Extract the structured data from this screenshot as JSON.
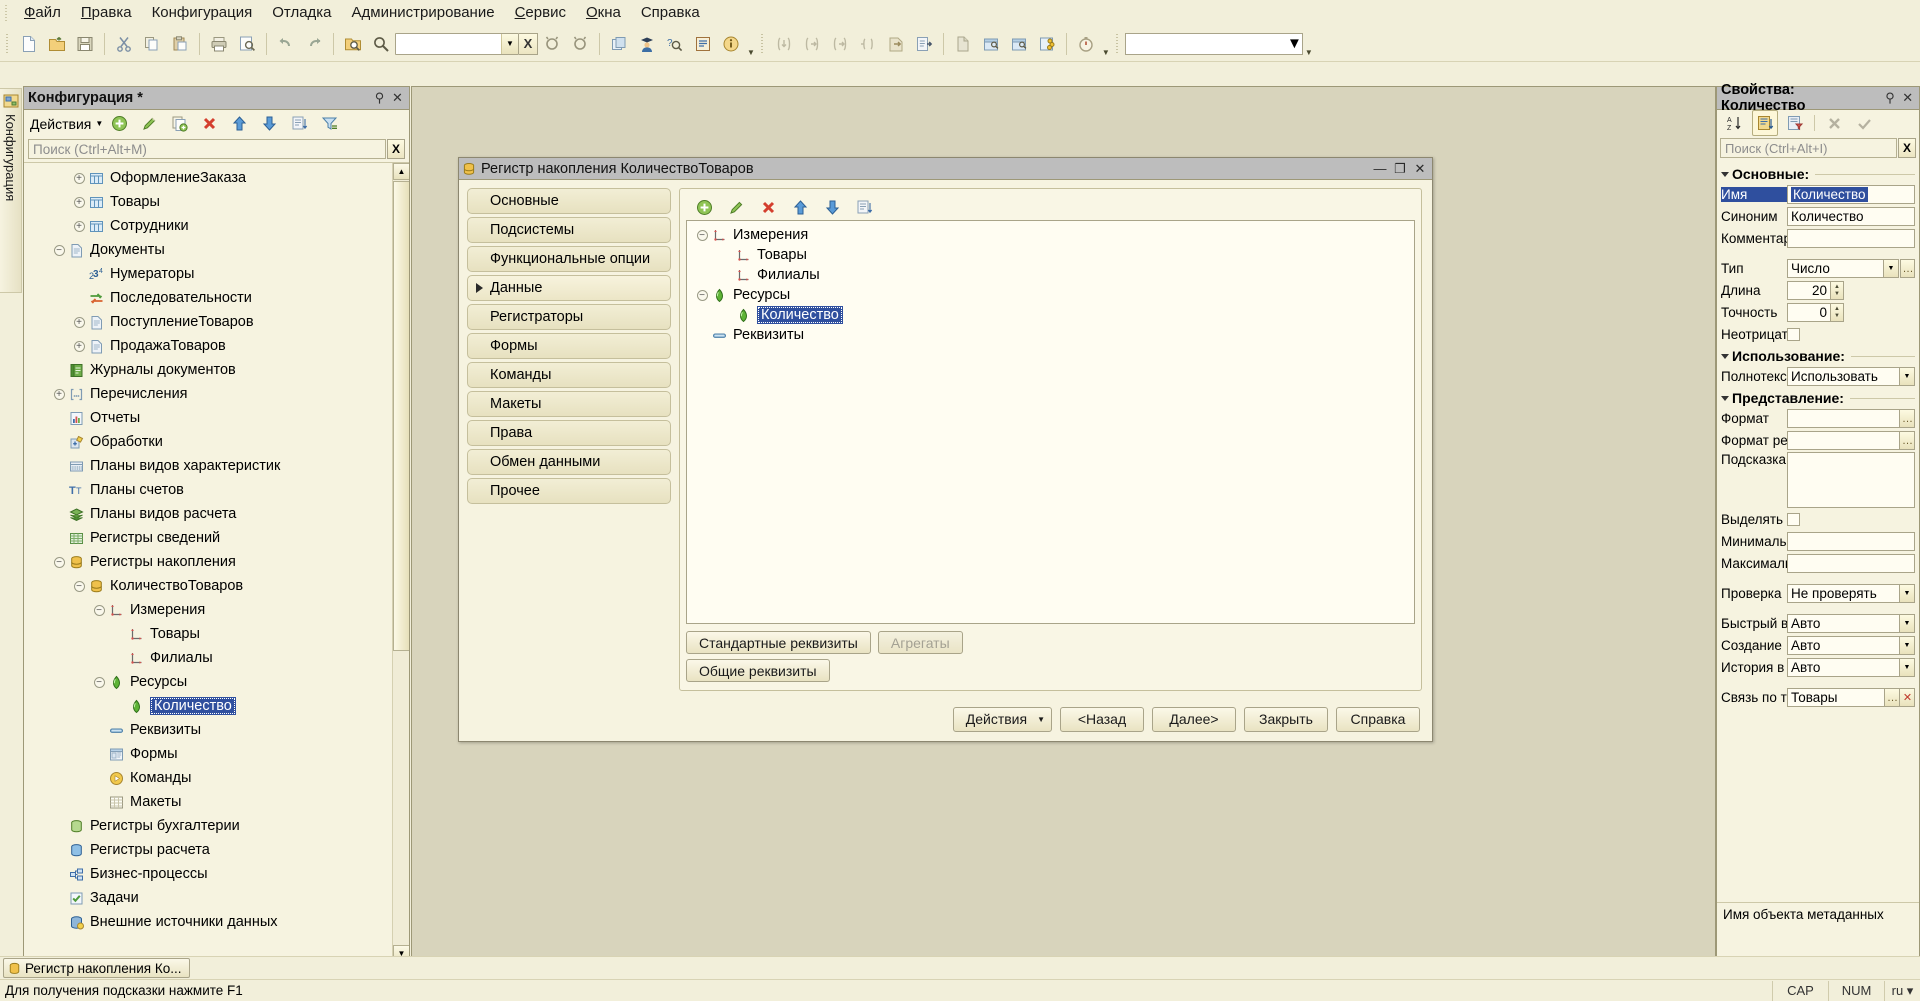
{
  "menu": {
    "items": [
      {
        "label": "Файл",
        "accel": "Ф"
      },
      {
        "label": "Правка",
        "accel": "П"
      },
      {
        "label": "Конфигурация",
        "accel": ""
      },
      {
        "label": "Отладка",
        "accel": ""
      },
      {
        "label": "Администрирование",
        "accel": ""
      },
      {
        "label": "Сервис",
        "accel": "С"
      },
      {
        "label": "Окна",
        "accel": "О"
      },
      {
        "label": "Справка",
        "accel": ""
      }
    ]
  },
  "toolbar": {
    "icons": [
      "new-file-icon",
      "open-folder-icon",
      "save-icon",
      "cut-icon",
      "copy-icon",
      "paste-icon",
      "print-icon",
      "print-preview-icon",
      "undo-icon",
      "redo-icon",
      "find-in-folder-icon",
      "search-icon"
    ],
    "search_value": "",
    "clear_label": "X",
    "icons2": [
      "user-icon",
      "find-user-icon",
      "syntax-helper-icon",
      "info-icon"
    ],
    "icons3": [
      "step-into-icon",
      "step-over-icon",
      "step-out-icon",
      "goto-line-icon",
      "run-to-cursor-icon",
      "next-statement-icon"
    ],
    "icons4": [
      "document-icon",
      "window-new-icon",
      "window-new2-icon",
      "config-compare-icon",
      "performance-icon"
    ],
    "combo2_value": ""
  },
  "vertical_tab": {
    "label": "Конфигурация"
  },
  "config_panel": {
    "title": "Конфигурация *",
    "actions_label": "Действия",
    "action_icons": [
      "add-icon",
      "edit-icon",
      "copy-add-icon",
      "delete-icon",
      "move-up-icon",
      "move-down-icon",
      "sort-icon",
      "filter-icon"
    ],
    "search_placeholder": "Поиск (Ctrl+Alt+M)",
    "search_clear": "X",
    "pin_icon": "pin-icon",
    "close_icon": "close-icon",
    "tree": [
      {
        "label": "ОформлениеЗаказа",
        "indent": 2,
        "expander": "+",
        "icon": "catalog-icon"
      },
      {
        "label": "Товары",
        "indent": 2,
        "expander": "+",
        "icon": "catalog-icon"
      },
      {
        "label": "Сотрудники",
        "indent": 2,
        "expander": "+",
        "icon": "catalog-icon"
      },
      {
        "label": "Документы",
        "indent": 1,
        "expander": "-",
        "icon": "document-icon"
      },
      {
        "label": "Нумераторы",
        "indent": 2,
        "expander": "",
        "icon": "numerator-icon"
      },
      {
        "label": "Последовательности",
        "indent": 2,
        "expander": "",
        "icon": "sequence-icon"
      },
      {
        "label": "ПоступлениеТоваров",
        "indent": 2,
        "expander": "+",
        "icon": "document-icon"
      },
      {
        "label": "ПродажаТоваров",
        "indent": 2,
        "expander": "+",
        "icon": "document-icon"
      },
      {
        "label": "Журналы документов",
        "indent": 1,
        "expander": "",
        "icon": "journal-icon"
      },
      {
        "label": "Перечисления",
        "indent": 1,
        "expander": "+",
        "icon": "enum-icon"
      },
      {
        "label": "Отчеты",
        "indent": 1,
        "expander": "",
        "icon": "report-icon"
      },
      {
        "label": "Обработки",
        "indent": 1,
        "expander": "",
        "icon": "dataproc-icon"
      },
      {
        "label": "Планы видов характеристик",
        "indent": 1,
        "expander": "",
        "icon": "chartofcharacteristic-icon"
      },
      {
        "label": "Планы счетов",
        "indent": 1,
        "expander": "",
        "icon": "chartofaccounts-icon"
      },
      {
        "label": "Планы видов расчета",
        "indent": 1,
        "expander": "",
        "icon": "chartofcalc-icon"
      },
      {
        "label": "Регистры сведений",
        "indent": 1,
        "expander": "",
        "icon": "inforegister-icon"
      },
      {
        "label": "Регистры накопления",
        "indent": 1,
        "expander": "-",
        "icon": "accumregister-icon"
      },
      {
        "label": "КоличествоТоваров",
        "indent": 2,
        "expander": "-",
        "icon": "accumregister-icon"
      },
      {
        "label": "Измерения",
        "indent": 3,
        "expander": "-",
        "icon": "dimension-icon"
      },
      {
        "label": "Товары",
        "indent": 4,
        "expander": "",
        "icon": "dimension-icon"
      },
      {
        "label": "Филиалы",
        "indent": 4,
        "expander": "",
        "icon": "dimension-icon"
      },
      {
        "label": "Ресурсы",
        "indent": 3,
        "expander": "-",
        "icon": "resource-icon"
      },
      {
        "label": "Количество",
        "indent": 4,
        "expander": "",
        "icon": "resource-icon",
        "selected": true
      },
      {
        "label": "Реквизиты",
        "indent": 3,
        "expander": "",
        "icon": "attribute-icon"
      },
      {
        "label": "Формы",
        "indent": 3,
        "expander": "",
        "icon": "form-icon"
      },
      {
        "label": "Команды",
        "indent": 3,
        "expander": "",
        "icon": "command-icon"
      },
      {
        "label": "Макеты",
        "indent": 3,
        "expander": "",
        "icon": "template-icon"
      },
      {
        "label": "Регистры бухгалтерии",
        "indent": 1,
        "expander": "",
        "icon": "accountregister-icon"
      },
      {
        "label": "Регистры расчета",
        "indent": 1,
        "expander": "",
        "icon": "calcregister-icon"
      },
      {
        "label": "Бизнес-процессы",
        "indent": 1,
        "expander": "",
        "icon": "businessprocess-icon"
      },
      {
        "label": "Задачи",
        "indent": 1,
        "expander": "",
        "icon": "task-icon"
      },
      {
        "label": "Внешние источники данных",
        "indent": 1,
        "expander": "",
        "icon": "externaldata-icon"
      }
    ]
  },
  "dialog": {
    "title": "Регистр накопления КоличествоТоваров",
    "icon": "accumregister-icon",
    "window_buttons": [
      "minimize",
      "maximize",
      "close"
    ],
    "nav_tabs": [
      {
        "label": "Основные",
        "active": false
      },
      {
        "label": "Подсистемы",
        "active": false
      },
      {
        "label": "Функциональные опции",
        "active": false
      },
      {
        "label": "Данные",
        "active": true
      },
      {
        "label": "Регистраторы",
        "active": false
      },
      {
        "label": "Формы",
        "active": false
      },
      {
        "label": "Команды",
        "active": false
      },
      {
        "label": "Макеты",
        "active": false
      },
      {
        "label": "Права",
        "active": false
      },
      {
        "label": "Обмен данными",
        "active": false
      },
      {
        "label": "Прочее",
        "active": false
      }
    ],
    "data_toolbar_icons": [
      "add-icon",
      "edit-icon",
      "delete-icon",
      "move-up-icon",
      "move-down-icon",
      "sort-icon"
    ],
    "data_tree": [
      {
        "label": "Измерения",
        "indent": 0,
        "expander": "-",
        "icon": "dimension-icon"
      },
      {
        "label": "Товары",
        "indent": 1,
        "expander": "",
        "icon": "dimension-icon"
      },
      {
        "label": "Филиалы",
        "indent": 1,
        "expander": "",
        "icon": "dimension-icon"
      },
      {
        "label": "Ресурсы",
        "indent": 0,
        "expander": "-",
        "icon": "resource-icon"
      },
      {
        "label": "Количество",
        "indent": 1,
        "expander": "",
        "icon": "resource-icon",
        "selected": true
      },
      {
        "label": "Реквизиты",
        "indent": 0,
        "expander": "",
        "icon": "attribute-icon"
      }
    ],
    "buttons": {
      "standard_attrs": "Стандартные реквизиты",
      "aggregates": "Агрегаты",
      "common_attrs": "Общие реквизиты",
      "actions": "Действия",
      "back": "<Назад",
      "next": "Далее>",
      "close": "Закрыть",
      "help": "Справка"
    }
  },
  "properties": {
    "title": "Свойства: Количество",
    "pin_icon": "pin-icon",
    "close_icon": "close-icon",
    "toolbar_icons": [
      "sort-az-icon",
      "group-by-category-icon",
      "filter-props-icon",
      "clear-icon",
      "apply-icon"
    ],
    "search_placeholder": "Поиск (Ctrl+Alt+I)",
    "search_clear": "X",
    "groups": [
      {
        "title": "Основные:",
        "rows": [
          {
            "label": "Имя",
            "value": "Количество",
            "type": "text",
            "label_selected": true,
            "value_selected": true
          },
          {
            "label": "Синоним",
            "value": "Количество",
            "type": "text"
          },
          {
            "label": "Комментар",
            "value": "",
            "type": "text"
          },
          {
            "label": "",
            "value": "",
            "type": "spacer"
          },
          {
            "label": "Тип",
            "value": "Число",
            "type": "combo-ellipsis"
          },
          {
            "label": "Длина",
            "value": "20",
            "type": "spinner"
          },
          {
            "label": "Точность",
            "value": "0",
            "type": "spinner"
          },
          {
            "label": "Неотрицат",
            "value": "",
            "type": "checkbox"
          }
        ]
      },
      {
        "title": "Использование:",
        "rows": [
          {
            "label": "Полнотекс",
            "value": "Использовать",
            "type": "combo"
          }
        ]
      },
      {
        "title": "Представление:",
        "rows": [
          {
            "label": "Формат",
            "value": "",
            "type": "ellipsis"
          },
          {
            "label": "Формат ре",
            "value": "",
            "type": "ellipsis"
          },
          {
            "label": "Подсказка",
            "value": "",
            "type": "multiline"
          },
          {
            "label": "Выделять ",
            "value": "",
            "type": "checkbox"
          },
          {
            "label": "Минималь",
            "value": "",
            "type": "text"
          },
          {
            "label": "Максималь",
            "value": "",
            "type": "text"
          },
          {
            "label": "",
            "value": "",
            "type": "spacer"
          },
          {
            "label": "Проверка ",
            "value": "Не проверять",
            "type": "combo"
          },
          {
            "label": "",
            "value": "",
            "type": "spacer"
          },
          {
            "label": "Быстрый в",
            "value": "Авто",
            "type": "combo"
          },
          {
            "label": "Создание ",
            "value": "Авто",
            "type": "combo"
          },
          {
            "label": "История в",
            "value": "Авто",
            "type": "combo"
          },
          {
            "label": "",
            "value": "",
            "type": "spacer"
          },
          {
            "label": "Связь по т",
            "value": "Товары",
            "type": "link"
          }
        ]
      }
    ],
    "description": "Имя объекта метаданных"
  },
  "taskbar": {
    "items": [
      {
        "label": "Регистр накопления Ко...",
        "icon": "accumregister-icon"
      }
    ]
  },
  "statusbar": {
    "text": "Для получения подсказки нажмите F1",
    "cells": [
      "CAP",
      "NUM",
      "ru ▾"
    ]
  }
}
